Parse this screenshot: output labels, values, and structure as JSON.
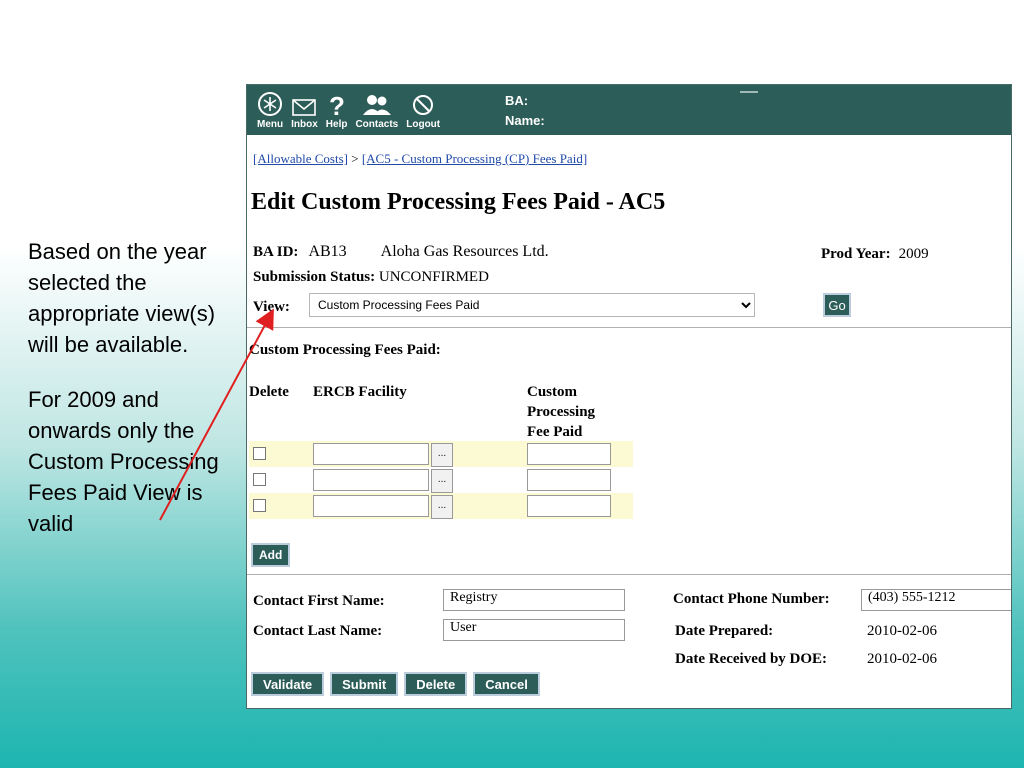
{
  "annotation": {
    "para1": "Based on the year selected the appropriate view(s) will be available.",
    "para2": "For 2009 and onwards only the Custom Processing Fees Paid View is valid"
  },
  "toolbar": {
    "items": [
      {
        "label": "Menu",
        "icon": "menu-icon"
      },
      {
        "label": "Inbox",
        "icon": "inbox-icon"
      },
      {
        "label": "Help",
        "icon": "help-icon"
      },
      {
        "label": "Contacts",
        "icon": "contacts-icon"
      },
      {
        "label": "Logout",
        "icon": "logout-icon"
      }
    ],
    "ba_label": "BA:",
    "name_label": "Name:"
  },
  "breadcrumb": {
    "link1": "[Allowable Costs]",
    "sep": " > ",
    "link2": "[AC5 - Custom Processing (CP) Fees Paid]"
  },
  "page_title": "Edit Custom Processing Fees Paid - AC5",
  "header": {
    "ba_id_label": "BA ID:",
    "ba_id": "AB13",
    "company": "Aloha Gas Resources Ltd.",
    "prod_year_label": "Prod Year:",
    "prod_year": "2009",
    "status_label": "Submission Status:",
    "status": "UNCONFIRMED",
    "view_label": "View:",
    "view_selected": "Custom Processing Fees Paid",
    "go_label": "Go"
  },
  "fees": {
    "section_title": "Custom Processing Fees Paid:",
    "col_delete": "Delete",
    "col_facility": "ERCB Facility",
    "col_fee_1": "Custom",
    "col_fee_2": "Processing",
    "col_fee_3": "Fee Paid",
    "lookup_label": "...",
    "add_label": "Add"
  },
  "contact": {
    "first_name_label": "Contact First Name:",
    "first_name": "Registry",
    "last_name_label": "Contact Last Name:",
    "last_name": "User",
    "phone_label": "Contact Phone Number:",
    "phone": "(403) 555-1212",
    "date_prepared_label": "Date Prepared:",
    "date_prepared": "2010-02-06",
    "date_received_label": "Date Received by DOE:",
    "date_received": "2010-02-06"
  },
  "actions": {
    "validate": "Validate",
    "submit": "Submit",
    "delete": "Delete",
    "cancel": "Cancel"
  },
  "colors": {
    "toolbar": "#2d5d58",
    "link": "#1f4aa8",
    "row_shade": "#fbfad2",
    "arrow": "#e02020"
  }
}
